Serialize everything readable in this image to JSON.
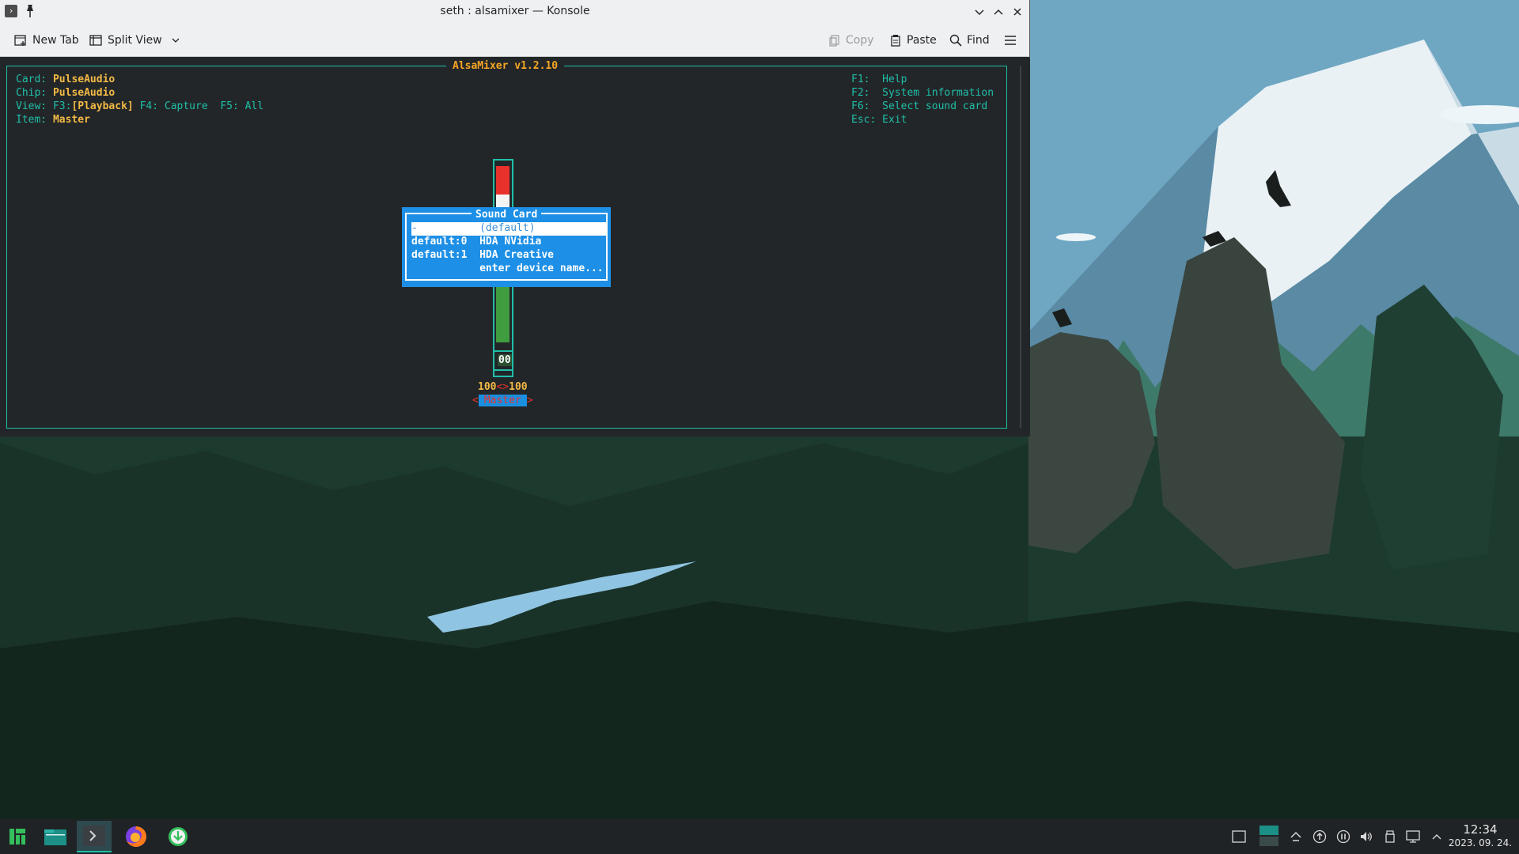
{
  "window": {
    "title": "seth : alsamixer — Konsole",
    "toolbar": {
      "new_tab": "New Tab",
      "split_view": "Split View",
      "copy": "Copy",
      "paste": "Paste",
      "find": "Find"
    }
  },
  "alsamixer": {
    "title": "AlsaMixer v1.2.10",
    "info": {
      "card_label": "Card:",
      "card_value": "PulseAudio",
      "chip_label": "Chip:",
      "chip_value": "PulseAudio",
      "view_label": "View:",
      "view_f3": "F3:",
      "view_playback": "[Playback]",
      "view_f4": "F4: Capture",
      "view_f5": "F5: All",
      "item_label": "Item:",
      "item_value": "Master"
    },
    "keys": [
      {
        "key": "F1:",
        "action": "Help"
      },
      {
        "key": "F2:",
        "action": "System information"
      },
      {
        "key": "F6:",
        "action": "Select sound card"
      },
      {
        "key": "Esc:",
        "action": "Exit"
      }
    ],
    "channel": {
      "value_box": "00",
      "left_level": "100",
      "separator": "<>",
      "right_level": "100",
      "arrow_left": "<",
      "name": "Master",
      "arrow_right": ">",
      "volume_fraction": 1.0
    },
    "sound_card_dialog": {
      "title": "Sound Card",
      "rows": [
        "-          (default)",
        "default:0  HDA NVidia",
        "default:1  HDA Creative",
        "           enter device name..."
      ],
      "selected_index": 0
    }
  },
  "taskbar": {
    "clock_time": "12:34",
    "clock_date": "2023. 09. 24."
  }
}
